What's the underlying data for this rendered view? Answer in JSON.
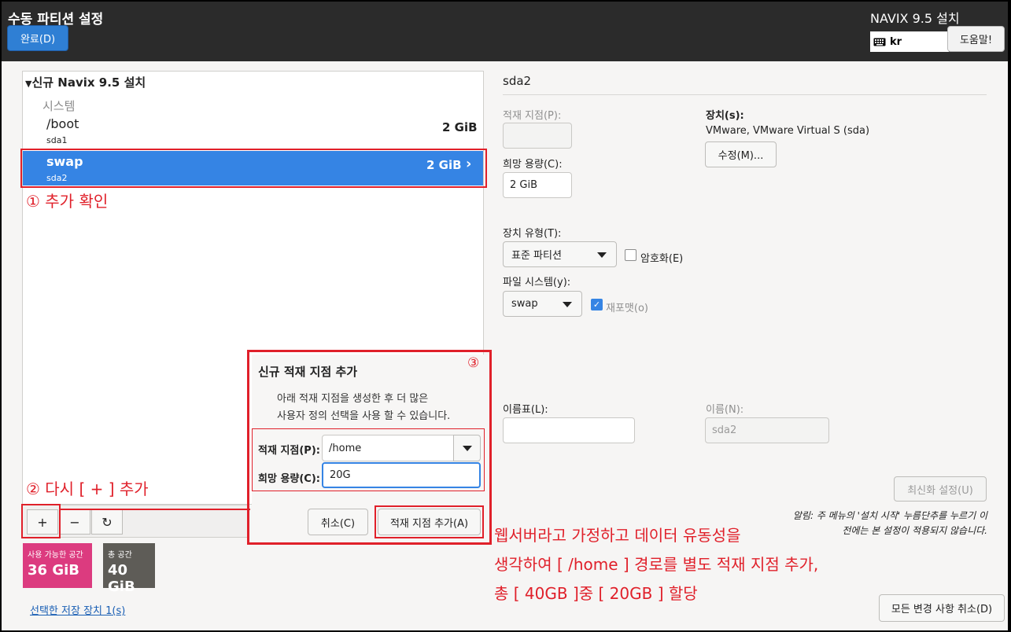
{
  "header": {
    "title": "수동 파티션 설정",
    "done_button": "완료(D)",
    "product": "NAVIX 9.5 설치",
    "keyboard_layout": "kr",
    "help_button": "도움말!"
  },
  "left_pane": {
    "install_title": "신규 Navix 9.5 설치",
    "system_label": "시스템",
    "partitions": [
      {
        "mount": "/boot",
        "device": "sda1",
        "size": "2 GiB",
        "selected": false
      },
      {
        "mount": "swap",
        "device": "sda2",
        "size": "2 GiB",
        "selected": true
      }
    ],
    "toolbar": {
      "add": "+",
      "remove": "−",
      "refresh": "↻"
    },
    "available_space": {
      "label": "사용 가능한 공간",
      "value": "36 GiB"
    },
    "total_space": {
      "label": "총 공간",
      "value": "40 GiB"
    },
    "selected_devices_link": "선택한 저장 장치 1(s)"
  },
  "right_pane": {
    "partition_name": "sda2",
    "mount_point_label": "적재 지점(P):",
    "mount_point_value": "",
    "desired_capacity_label": "희망 용량(C):",
    "desired_capacity_value": "2 GiB",
    "device_label": "장치(s):",
    "device_value": "VMware, VMware Virtual S (sda)",
    "modify_button": "수정(M)...",
    "device_type_label": "장치 유형(T):",
    "device_type_value": "표준 파티션",
    "encrypt_label": "암호화(E)",
    "encrypt_checked": false,
    "filesystem_label": "파일 시스템(y):",
    "filesystem_value": "swap",
    "reformat_label": "재포맷(o)",
    "reformat_checked": true,
    "label_label": "이름표(L):",
    "label_value": "",
    "name_label": "이름(N):",
    "name_value": "sda2",
    "update_button": "최신화 설정(U)",
    "notice_line1": "알림: 주 메뉴의 '설치 시작' 누름단추를 누르기 이",
    "notice_line2": "전에는 본 설정이 적용되지 않습니다.",
    "reset_button": "모든 변경 사항 취소(D)"
  },
  "dialog": {
    "title": "신규 적재 지점 추가",
    "desc_line1": "아래 적재 지점을 생성한 후 더 많은",
    "desc_line2": "사용자 정의 선택을 사용 할 수 있습니다.",
    "mount_label": "적재 지점(P):",
    "mount_value": "/home",
    "capacity_label": "희망 용량(C):",
    "capacity_value": "20G",
    "cancel_button": "취소(C)",
    "add_button": "적재 지점 추가(A)"
  },
  "annotations": {
    "a1": "① 추가 확인",
    "a2": "② 다시 [ + ] 추가",
    "a3": "③",
    "main_line1": "웹서버라고 가정하고 데이터 유동성을",
    "main_line2": "생각하여 [ /home ] 경로를 별도 적재 지점 추가,",
    "main_line3": "총 [ 40GB ]중 [ 20GB ] 할당",
    "color": "#e0202a"
  }
}
